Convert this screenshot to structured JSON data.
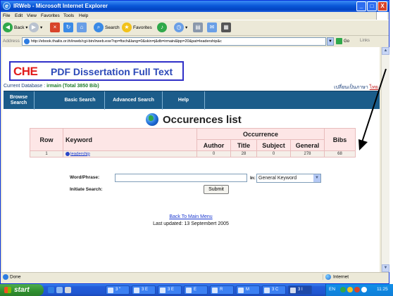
{
  "window": {
    "title": "IRWeb - Microsoft Internet Explorer",
    "minimize": "_",
    "maximize": "□",
    "close": "X"
  },
  "menu": [
    "File",
    "Edit",
    "View",
    "Favorites",
    "Tools",
    "Help"
  ],
  "toolbar": {
    "back": "Back",
    "search": "Search",
    "favorites": "Favorites"
  },
  "address": {
    "label": "Address",
    "url": "http://ebook.thailis.or.th/irweb/cgi-bin/irweb.exe?op=ftsch&lang=0&skin=j&db=irmain&lpp=20&pat=leadership&c",
    "go": "Go",
    "links": "Links"
  },
  "logo": {
    "mark": "CHE",
    "text": "PDF Dissertation Full Text"
  },
  "database": {
    "label": "Current Database :",
    "name": "irmain (Total 3850 Bib)",
    "lang_switch": "เปลี่ยนเป็นภาษา",
    "lang_link": "ไทย"
  },
  "nav": {
    "browse": "Browse Search",
    "basic": "Basic Search",
    "advanced": "Advanced Search",
    "help": "Help"
  },
  "occurrences": {
    "title": "Occurences list",
    "headers": {
      "row": "Row",
      "keyword": "Keyword",
      "occurrence": "Occurrence",
      "author": "Author",
      "title": "Title",
      "subject": "Subject",
      "general": "General",
      "bibs": "Bibs"
    },
    "rows": [
      {
        "row": "1",
        "keyword": "leadership",
        "author": "0",
        "title": "28",
        "subject": "0",
        "general": "278",
        "bibs": "68"
      }
    ]
  },
  "search_form": {
    "word_label": "Word/Phrase:",
    "word_value": "",
    "in_label": "In:",
    "field_selected": "General Keyword",
    "initiate_label": "Initiate Search:",
    "submit": "Submit"
  },
  "footer": {
    "back_link": "Back To Main Menu",
    "updated": "Last updated: 13 Septembert 2005"
  },
  "status": {
    "left": "Done",
    "zone": "Internet"
  },
  "taskbar": {
    "start": "start",
    "tasks": [
      "3 \"",
      "3 E",
      "3 E",
      "E",
      "R",
      "M",
      "3 C",
      "3 I"
    ],
    "language": "EN",
    "clock": "11:25"
  },
  "colors": {
    "nav_bg": "#1b5c8a",
    "table_bg": "#fde6e6",
    "logo_border": "#3030c8",
    "logo_text": "#2c49b8",
    "logo_mark": "#e11b1b"
  }
}
